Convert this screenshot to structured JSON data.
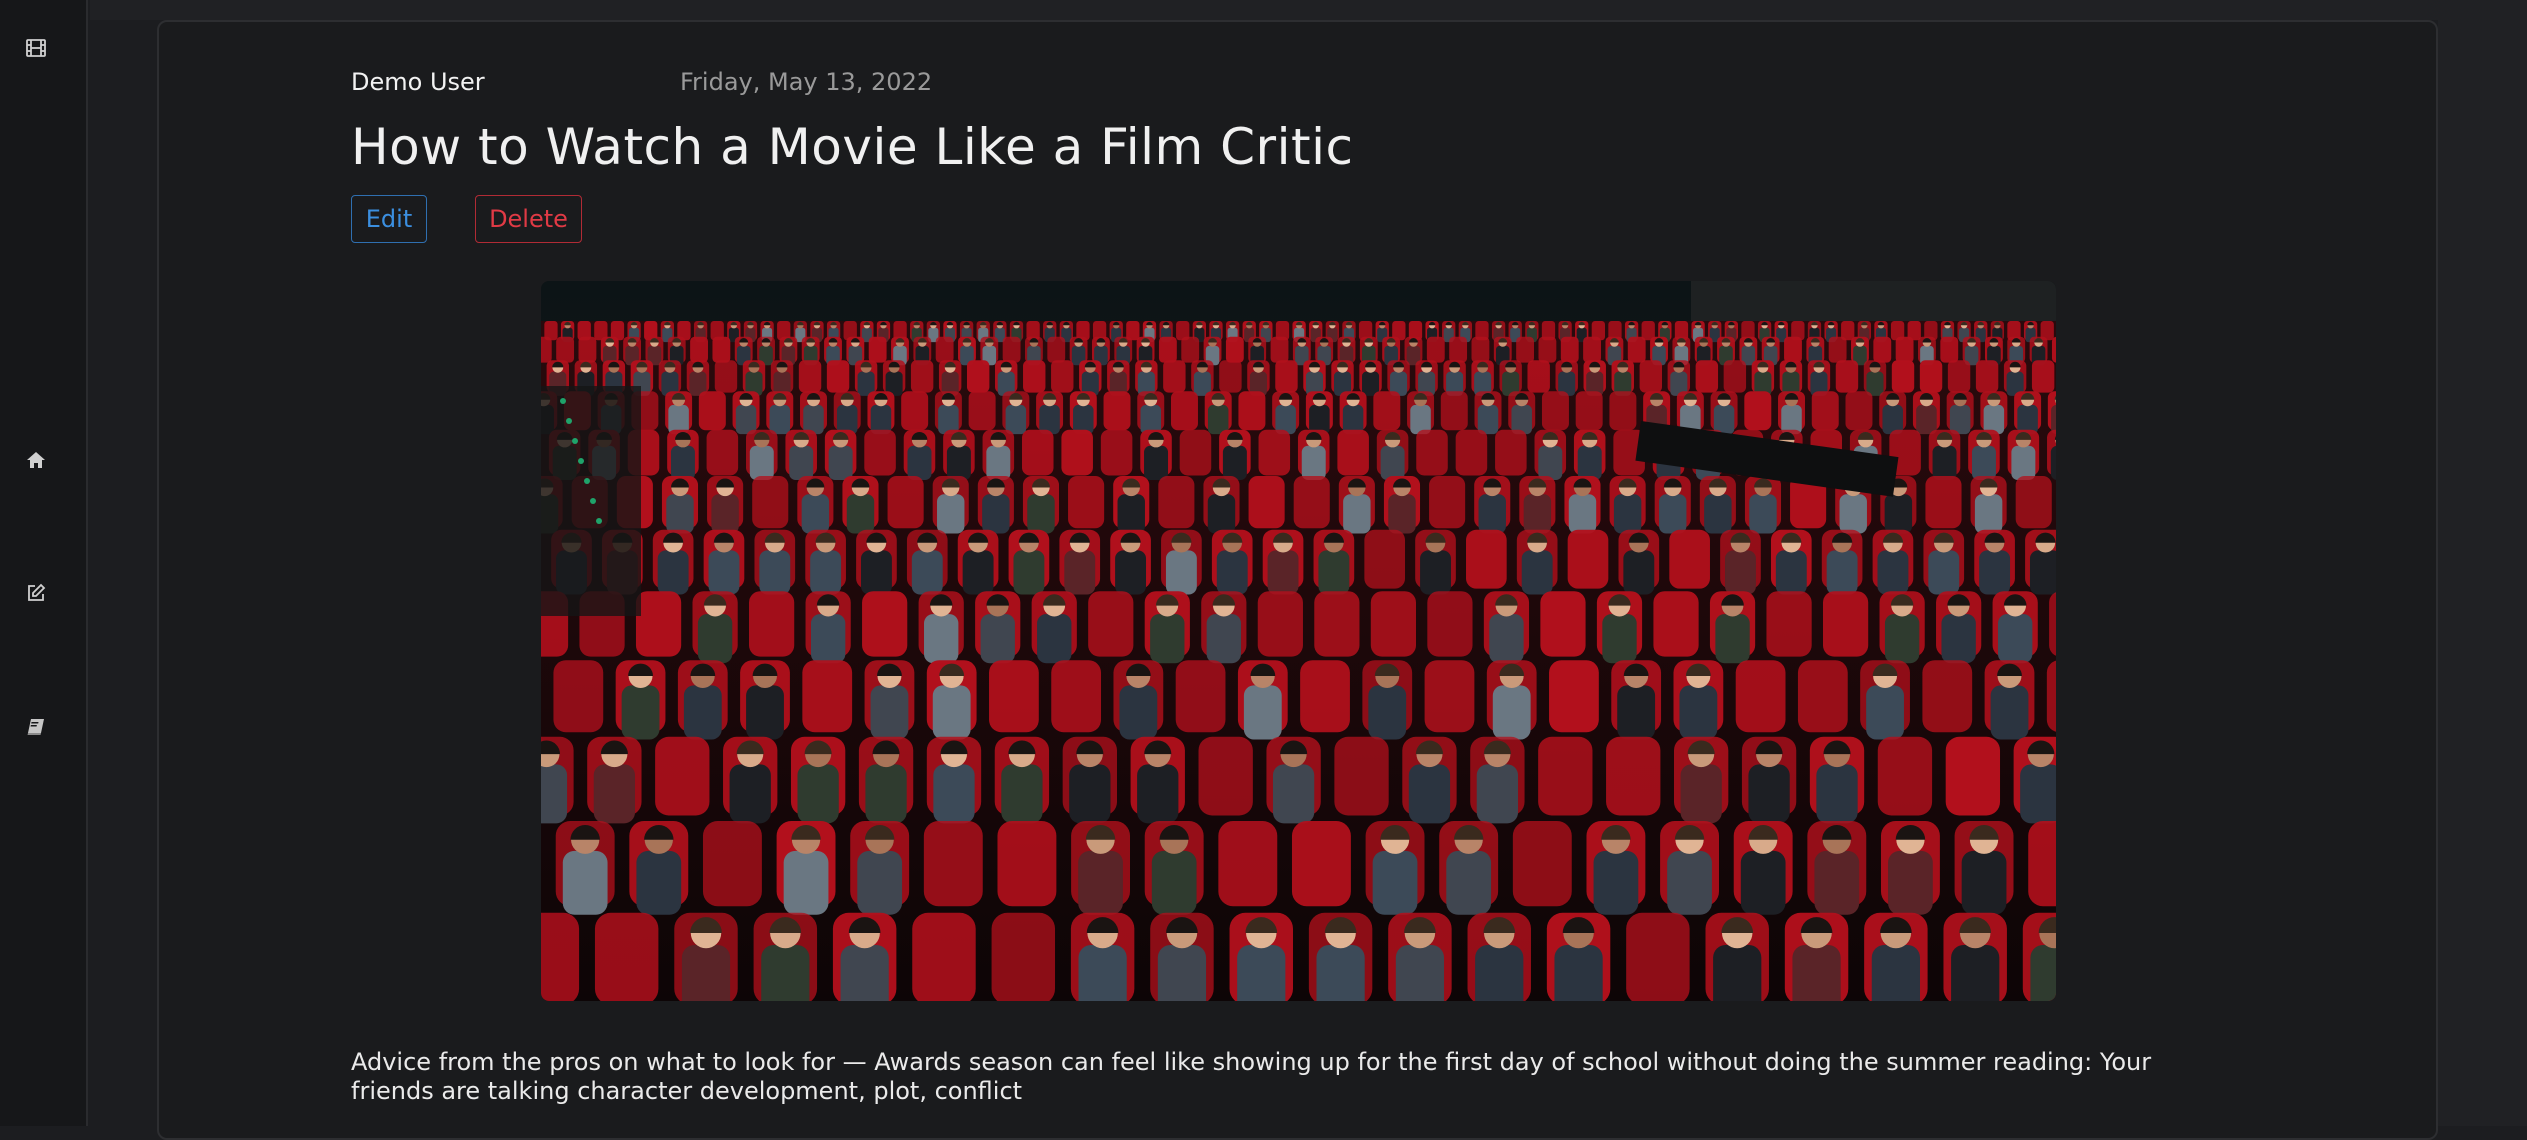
{
  "sidebar": {
    "icons": [
      "film-icon",
      "home-icon",
      "edit-icon",
      "book-icon"
    ]
  },
  "post": {
    "author": "Demo User",
    "date": "Friday, May 13, 2022",
    "title": "How to Watch a Movie Like a Film Critic",
    "edit_label": "Edit",
    "delete_label": "Delete",
    "body": "Advice from the pros on what to look for — Awards season can feel like showing up for the first day of school without doing the summer reading: Your friends are talking character development, plot, conflict"
  },
  "colors": {
    "edit": "#3b8fe0",
    "delete": "#e03a45",
    "seat_red": "#b3101c"
  }
}
